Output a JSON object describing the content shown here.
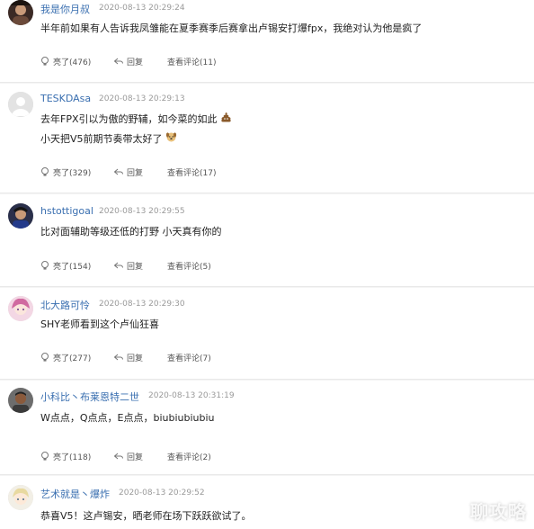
{
  "comments": [
    {
      "username": "我是你月叔",
      "timestamp": "2020-08-13 20:29:24",
      "lines": [
        "半年前如果有人告诉我凤雏能在夏季赛季后赛拿出卢锡安打爆fpx，我绝对认为他是疯了"
      ],
      "likes": "亮了(476)",
      "reply": "回复",
      "view_replies": "查看评论(11)"
    },
    {
      "username": "TESKDAsa",
      "timestamp": "2020-08-13 20:29:13",
      "lines": [
        "去年FPX引以为傲的野辅，如今菜的如此",
        "小天把V5前期节奏带太好了"
      ],
      "likes": "亮了(329)",
      "reply": "回复",
      "view_replies": "查看评论(17)"
    },
    {
      "username": "hstottigoal",
      "timestamp": "2020-08-13 20:29:55",
      "lines": [
        "比对面辅助等级还低的打野 小天真有你的"
      ],
      "likes": "亮了(154)",
      "reply": "回复",
      "view_replies": "查看评论(5)"
    },
    {
      "username": "北大路可怜",
      "timestamp": "2020-08-13 20:29:30",
      "lines": [
        "SHY老师看到这个卢仙狂喜"
      ],
      "likes": "亮了(277)",
      "reply": "回复",
      "view_replies": "查看评论(7)"
    },
    {
      "username": "小科比丶布莱恩特二世",
      "timestamp": "2020-08-13 20:31:19",
      "lines": [
        "W点点，Q点点，E点点，biubiubiubiu"
      ],
      "likes": "亮了(118)",
      "reply": "回复",
      "view_replies": "查看评论(2)"
    },
    {
      "username": "艺术就是丶爆炸",
      "timestamp": "2020-08-13 20:29:52",
      "lines": [
        "恭喜V5！这卢锡安，晒老师在场下跃跃欲试了。"
      ],
      "likes": "",
      "reply": "",
      "view_replies": ""
    }
  ],
  "watermark": "聊攻略",
  "colors": {
    "username": "#3a6fb0",
    "timestamp": "#9a9a9a",
    "action_text": "#555555",
    "background": "#ffffff",
    "divider": "#e9e9e9"
  },
  "icons": {
    "like": "lightbulb-icon",
    "reply": "reply-arrow-icon"
  }
}
